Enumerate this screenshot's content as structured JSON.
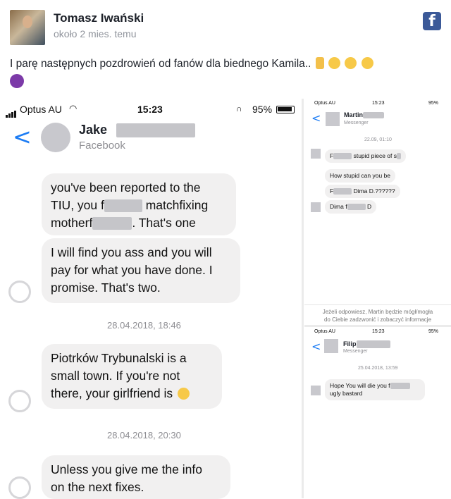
{
  "post": {
    "author": "Tomasz Iwański",
    "time": "około 2 mies. temu",
    "text": "I parę następnych pozdrowień od fanów dla biednego Kamila..",
    "fb_glyph": "f"
  },
  "left_phone": {
    "carrier": "Optus AU",
    "clock": "15:23",
    "battery": "95%",
    "contact_name": "Jake",
    "contact_sub": "Facebook",
    "back_glyph": "<",
    "messages": [
      {
        "text_html_parts": [
          "you've been reported to the",
          "TIU, you f",
          " matchfixing",
          "motherf",
          ". That's one"
        ]
      },
      {
        "text": [
          "I will find you ass and you will",
          "pay for what you have done. I",
          "promise. That's two."
        ]
      },
      {
        "text": [
          "Piotrków Trybunalski is a",
          "small town. If you're not",
          "there, your girlfriend is"
        ]
      },
      {
        "text": [
          "Unless you give me the info",
          "on the next fixes."
        ]
      }
    ],
    "timestamps": [
      "28.04.2018, 18:46",
      "28.04.2018, 20:30"
    ]
  },
  "right_top": {
    "carrier": "Optus AU",
    "clock": "15:23",
    "battery": "95%",
    "contact_name": "Martin",
    "contact_sub": "Messenger",
    "timestamp": "22.09, 01:10",
    "messages": [
      "F",
      "stupid piece of s",
      "How stupid can you be",
      "F",
      "Dima D.??????",
      "Dima f",
      "D"
    ],
    "footer": [
      "Jeżeli odpowiesz, Martin będzie mógł/mogła",
      "do Ciebie zadzwonić i zobaczyć informacje"
    ]
  },
  "right_bottom": {
    "carrier": "Optus AU",
    "clock": "15:23",
    "battery": "95%",
    "contact_name": "Filip",
    "contact_sub": "Messenger",
    "timestamp": "25.04.2018, 13:59",
    "messages": [
      "Hope You will die you f",
      "ugly bastard"
    ]
  },
  "icons": [
    "facebook-icon",
    "back-chevron-icon",
    "signal-icon",
    "wifi-icon",
    "battery-icon",
    "headphones-icon",
    "emoji-icon",
    "devil-emoji-icon"
  ]
}
